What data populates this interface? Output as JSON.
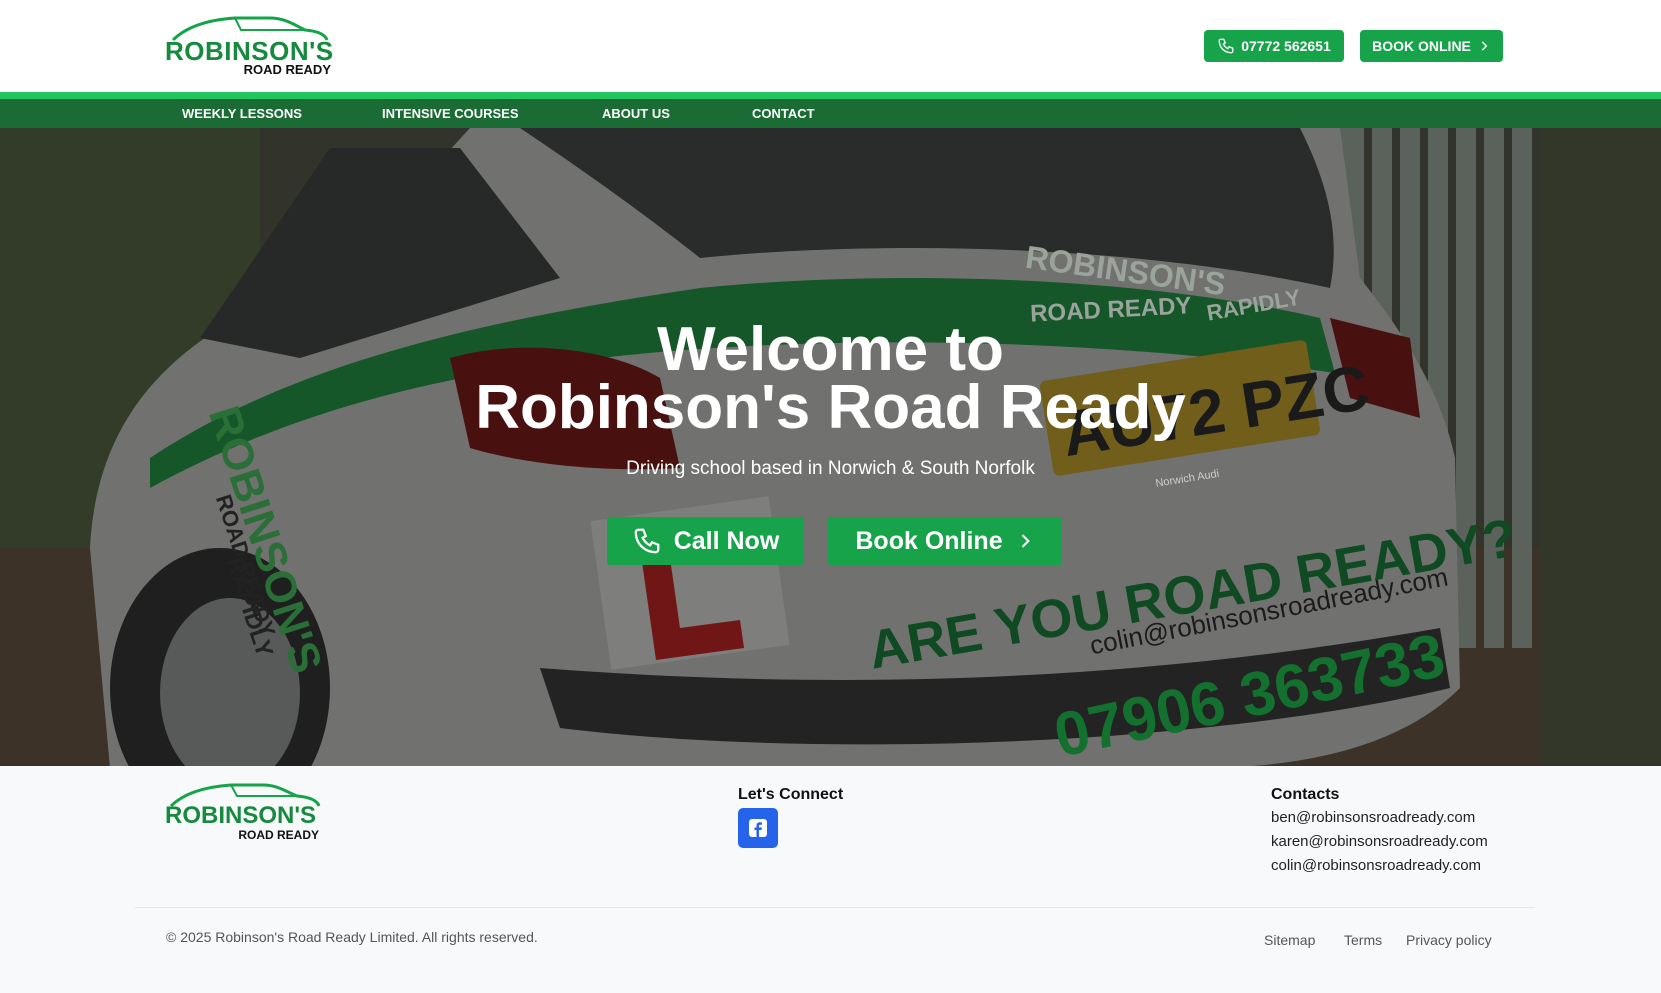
{
  "brand": {
    "name": "ROBINSON'S",
    "tagline": "ROAD READY",
    "color_primary": "#16a34a",
    "color_dark": "#1b6b35"
  },
  "header": {
    "phone_label": "07772 562651",
    "book_label": "BOOK ONLINE"
  },
  "nav": {
    "items": [
      {
        "label": "WEEKLY LESSONS"
      },
      {
        "label": "INTENSIVE COURSES"
      },
      {
        "label": "ABOUT US"
      },
      {
        "label": "CONTACT"
      }
    ]
  },
  "hero": {
    "title_line1": "Welcome to",
    "title_line2": "Robinson's Road Ready",
    "subtitle": "Driving school based in Norwich & South Norfolk",
    "call_label": "Call Now",
    "book_label": "Book Online",
    "car_text": {
      "plate": "AU72 PZC",
      "tagline": "ARE YOU ROAD READY?",
      "email": "colin@robinsonsroadready.com",
      "phone": "07906 363733",
      "side_brand": "ROBINSON'S",
      "side_sub": "ROAD READY",
      "side_rapid": "RAPIDLY",
      "rear_brand": "ROBINSON'S",
      "rear_sub": "ROAD READY",
      "rear_rapid": "RAPIDLY",
      "learner": "L",
      "dealer": "Norwich Audi"
    }
  },
  "footer": {
    "connect_heading": "Let's Connect",
    "contacts_heading": "Contacts",
    "contacts": [
      "ben@robinsonsroadready.com",
      "karen@robinsonsroadready.com",
      "colin@robinsonsroadready.com"
    ],
    "copyright": "© 2025 Robinson's Road Ready Limited. All rights reserved.",
    "links": {
      "sitemap": "Sitemap",
      "terms": "Terms",
      "privacy": "Privacy policy"
    }
  },
  "icons": {
    "phone": "phone-icon",
    "chevron": "chevron-right-icon",
    "facebook": "facebook-icon",
    "car": "car-outline-icon"
  }
}
